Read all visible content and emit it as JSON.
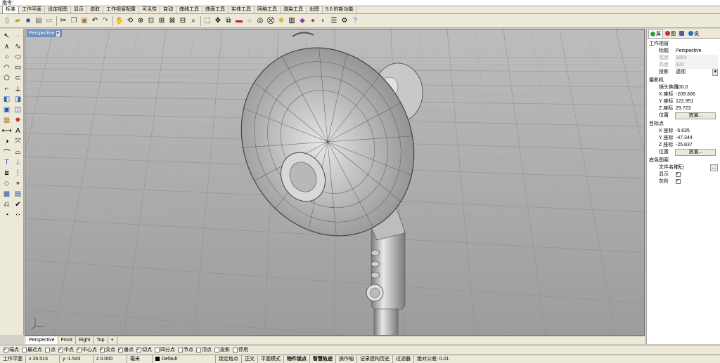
{
  "command": {
    "prompt": "指令:"
  },
  "menu_tabs": [
    "标准",
    "工作平面",
    "设定视图",
    "显示",
    "选取",
    "工作视窗配置",
    "可见性",
    "变动",
    "曲线工具",
    "曲面工具",
    "实体工具",
    "网格工具",
    "渲染工具",
    "出图",
    "5.0 的新功能"
  ],
  "viewport": {
    "label": "Perspective"
  },
  "view_tabs": [
    "Perspective",
    "Front",
    "Right",
    "Top",
    "+"
  ],
  "right_panel": {
    "tabs": [
      "属",
      "图",
      "",
      "说"
    ],
    "viewport_section": "工作视窗",
    "title_label": "标题",
    "title_value": "Perspective",
    "width_label": "宽度",
    "width_value": "1654",
    "height_label": "高度",
    "height_value": "820",
    "proj_label": "投影",
    "proj_value": "透视",
    "camera_section": "摄影机",
    "lens_label": "镜头焦距",
    "lens_value": "100.0",
    "cx_label": "X 座标",
    "cx_value": "-209.306",
    "cy_label": "Y 座标",
    "cy_value": "122.951",
    "cz_label": "Z 座标",
    "cz_value": "29.723",
    "cpos_label": "位置",
    "cpos_btn": "放置...",
    "target_section": "目标点",
    "tx_label": "X 座标",
    "tx_value": "-5.635",
    "ty_label": "Y 座标",
    "ty_value": "-47.344",
    "tz_label": "Z 座标",
    "tz_value": "-25.837",
    "tpos_label": "位置",
    "tpos_btn": "放置...",
    "bg_section": "底色图案",
    "file_label": "文件名称",
    "file_value": "(无)",
    "show_label": "显示",
    "gray_label": "灰阶"
  },
  "osnaps": [
    {
      "label": "端点",
      "on": true
    },
    {
      "label": "最近点",
      "on": false
    },
    {
      "label": "点",
      "on": false
    },
    {
      "label": "中点",
      "on": true
    },
    {
      "label": "中心点",
      "on": true
    },
    {
      "label": "交点",
      "on": true
    },
    {
      "label": "垂点",
      "on": true
    },
    {
      "label": "切点",
      "on": true
    },
    {
      "label": "四分点",
      "on": false
    },
    {
      "label": "节点",
      "on": false
    },
    {
      "label": "顶点",
      "on": false
    },
    {
      "label": "投影",
      "on": false
    },
    {
      "label": "停用",
      "on": false
    }
  ],
  "status": {
    "plane": "工作平面",
    "x": "x 26.513",
    "y": "y -1.543",
    "z": "z 0.000",
    "unit": "毫米",
    "layer": "Default",
    "lock_grid": "锁定格点",
    "ortho": "正交",
    "planar": "平面模式",
    "osnap": "物件锁点",
    "smarttrack": "智慧轨迹",
    "gumball": "操作轴",
    "history": "记录建构历史",
    "filter": "过滤器",
    "tolerance": "绝对公差: 0.01"
  }
}
